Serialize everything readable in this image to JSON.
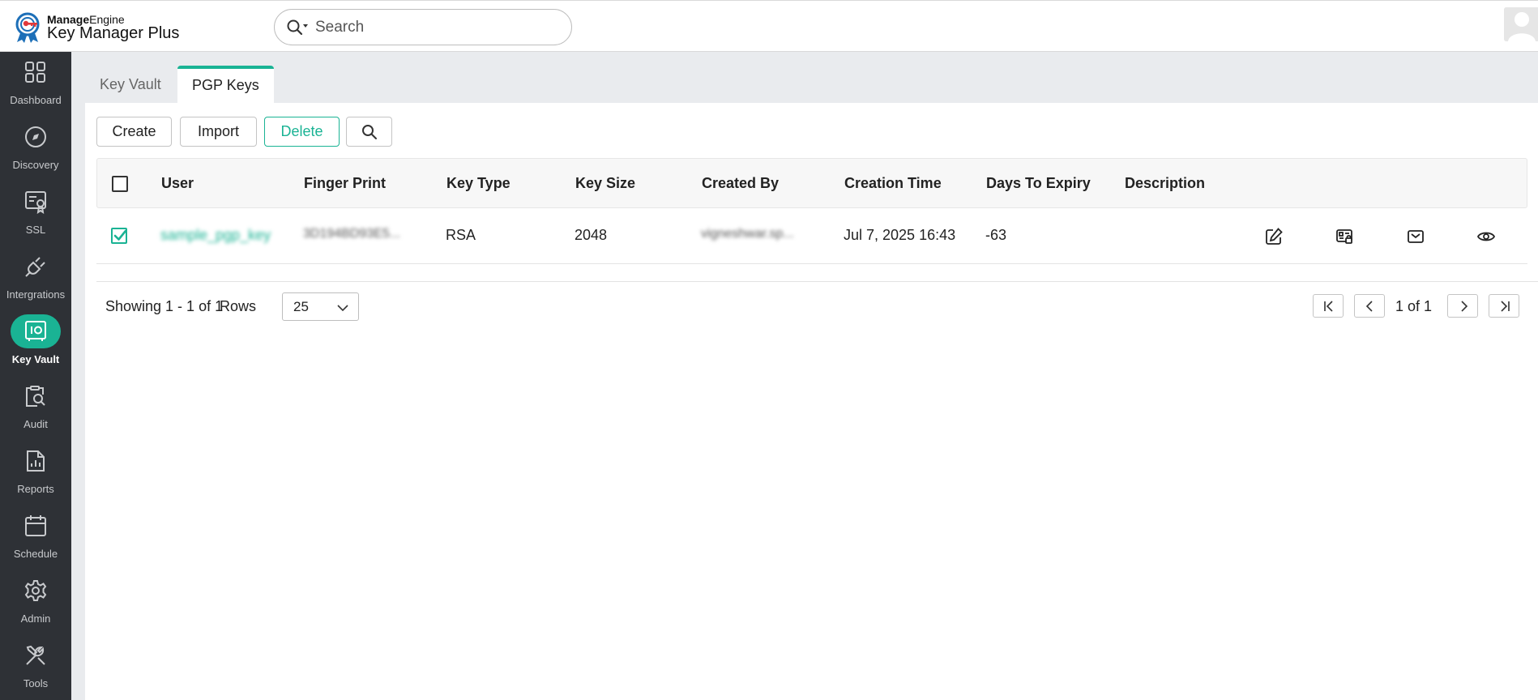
{
  "header": {
    "brand_manage": "Manage",
    "brand_engine": "Engine",
    "product_bold": "Key Manager",
    "product_light": " Plus",
    "search_placeholder": "Search"
  },
  "sidebar": {
    "items": [
      {
        "label": "Dashboard",
        "icon": "grid-icon"
      },
      {
        "label": "Discovery",
        "icon": "compass-icon"
      },
      {
        "label": "SSL",
        "icon": "certificate-icon"
      },
      {
        "label": "Intergrations",
        "icon": "plug-icon"
      },
      {
        "label": "Key Vault",
        "icon": "vault-icon",
        "active": true
      },
      {
        "label": "Audit",
        "icon": "audit-icon"
      },
      {
        "label": "Reports",
        "icon": "report-icon"
      },
      {
        "label": "Schedule",
        "icon": "calendar-icon"
      },
      {
        "label": "Admin",
        "icon": "gear-icon"
      },
      {
        "label": "Tools",
        "icon": "tools-icon"
      }
    ]
  },
  "tabs": [
    {
      "label": "Key Vault"
    },
    {
      "label": "PGP Keys",
      "active": true
    }
  ],
  "toolbar": {
    "create_label": "Create",
    "import_label": "Import",
    "delete_label": "Delete"
  },
  "table": {
    "columns": [
      "User",
      "Finger Print",
      "Key Type",
      "Key Size",
      "Created By",
      "Creation Time",
      "Days To Expiry",
      "Description"
    ],
    "rows": [
      {
        "selected": true,
        "user": "sample_pgp_key",
        "fingerprint": "3D194BD93E5...",
        "key_type": "RSA",
        "key_size": "2048",
        "created_by": "vigneshwar.sp...",
        "creation_time": "Jul 7, 2025 16:43",
        "days_to_expiry": "-63",
        "description": ""
      }
    ]
  },
  "pagination": {
    "showing": "Showing 1 - 1 of 1",
    "rows_label": "Rows",
    "rows_value": "25",
    "page_text": "1 of 1"
  },
  "colors": {
    "accent": "#1ab394",
    "sidebar_bg": "#2e3136",
    "content_bg": "#e9ebee"
  }
}
